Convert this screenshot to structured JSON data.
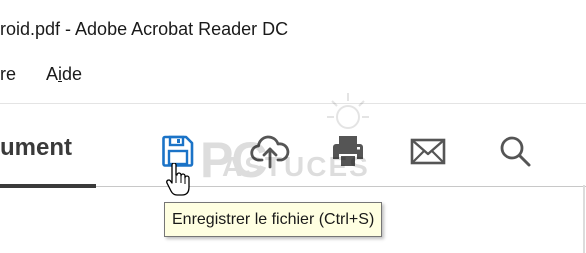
{
  "window": {
    "title": "roid.pdf - Adobe Acrobat Reader DC"
  },
  "menubar": {
    "partial_item": "re",
    "aide": {
      "before": "A",
      "accel": "i",
      "after": "de"
    }
  },
  "toolbar": {
    "tab_label": "ument",
    "tools": [
      {
        "name": "save-file",
        "icon": "floppy-disk-icon"
      },
      {
        "name": "upload",
        "icon": "cloud-upload-icon"
      },
      {
        "name": "print",
        "icon": "printer-icon"
      },
      {
        "name": "email",
        "icon": "envelope-icon"
      },
      {
        "name": "search",
        "icon": "magnifier-icon"
      }
    ]
  },
  "watermark": {
    "brand_main": "PC",
    "brand_sub": "ASTUCES"
  },
  "tooltip": {
    "text": "Enregistrer le fichier (Ctrl+S)"
  },
  "colors": {
    "accent_blue": "#1b73c7",
    "icon_gray": "#555555",
    "tooltip_bg": "#ffffe1",
    "text": "#1a1a1a"
  }
}
